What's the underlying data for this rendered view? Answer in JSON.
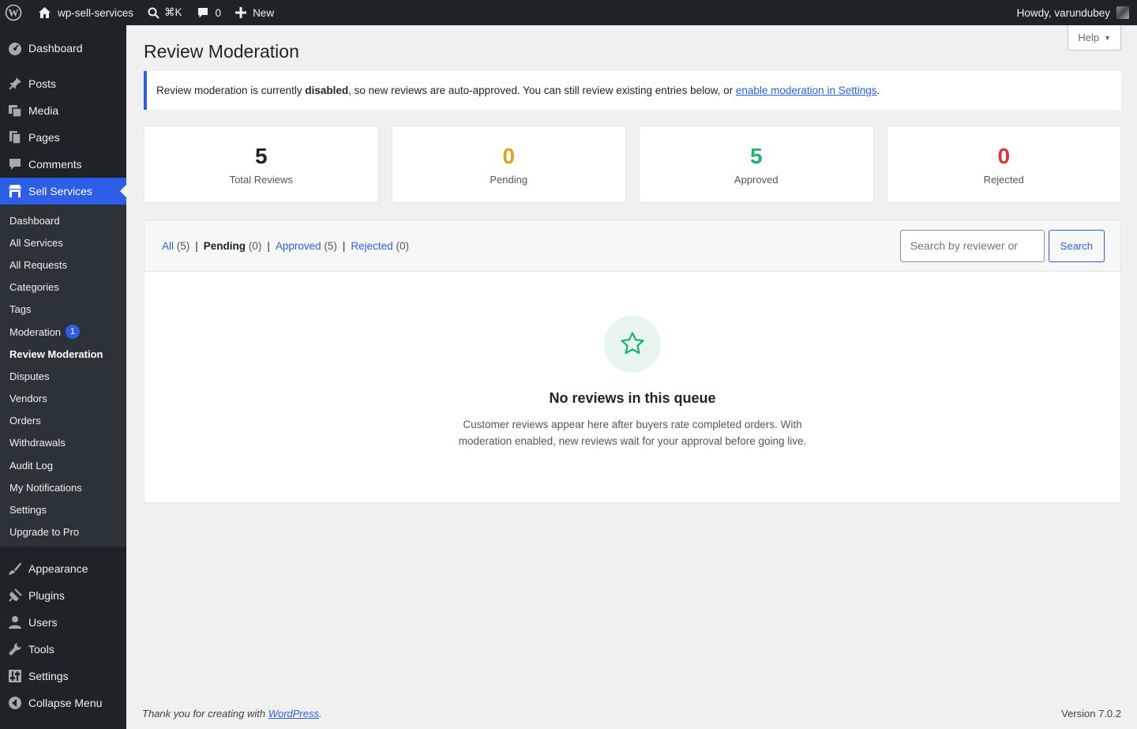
{
  "adminbar": {
    "site_name": "wp-sell-services",
    "search_shortcut": "⌘K",
    "comments_count": "0",
    "new_label": "New",
    "howdy": "Howdy, varundubey"
  },
  "sidebar": {
    "top_items": [
      {
        "label": "Dashboard"
      },
      {
        "label": "Posts"
      },
      {
        "label": "Media"
      },
      {
        "label": "Pages"
      },
      {
        "label": "Comments"
      },
      {
        "label": "Sell Services"
      }
    ],
    "submenu": [
      {
        "label": "Dashboard"
      },
      {
        "label": "All Services"
      },
      {
        "label": "All Requests"
      },
      {
        "label": "Categories"
      },
      {
        "label": "Tags"
      },
      {
        "label": "Moderation",
        "badge": "1"
      },
      {
        "label": "Review Moderation"
      },
      {
        "label": "Disputes"
      },
      {
        "label": "Vendors"
      },
      {
        "label": "Orders"
      },
      {
        "label": "Withdrawals"
      },
      {
        "label": "Audit Log"
      },
      {
        "label": "My Notifications"
      },
      {
        "label": "Settings"
      },
      {
        "label": "Upgrade to Pro"
      }
    ],
    "bottom_items": [
      {
        "label": "Appearance"
      },
      {
        "label": "Plugins"
      },
      {
        "label": "Users"
      },
      {
        "label": "Tools"
      },
      {
        "label": "Settings"
      },
      {
        "label": "Collapse Menu"
      }
    ]
  },
  "help_label": "Help",
  "page_title": "Review Moderation",
  "notice": {
    "text_before": "Review moderation is currently ",
    "bold": "disabled",
    "text_after": ", so new reviews are auto-approved. You can still review existing entries below, or ",
    "link": "enable moderation in Settings",
    "end": "."
  },
  "stats": [
    {
      "value": "5",
      "label": "Total Reviews",
      "color": "#1d2327"
    },
    {
      "value": "0",
      "label": "Pending",
      "color": "#dba617"
    },
    {
      "value": "5",
      "label": "Approved",
      "color": "#1fb36b"
    },
    {
      "value": "0",
      "label": "Rejected",
      "color": "#d63638"
    }
  ],
  "filters": [
    {
      "label": "All",
      "count": "(5)"
    },
    {
      "label": "Pending",
      "count": "(0)"
    },
    {
      "label": "Approved",
      "count": "(5)"
    },
    {
      "label": "Rejected",
      "count": "(0)"
    }
  ],
  "search": {
    "placeholder": "Search by reviewer or",
    "button": "Search"
  },
  "empty": {
    "title": "No reviews in this queue",
    "description": "Customer reviews appear here after buyers rate completed orders. With moderation enabled, new reviews wait for your approval before going live."
  },
  "footer": {
    "thanks_before": "Thank you for creating with ",
    "thanks_link": "WordPress",
    "thanks_after": ".",
    "version": "Version 7.0.2"
  },
  "colors": {
    "accent": "#2c5ee8",
    "sidebar_bg": "#1d2327",
    "success": "#1fb36b",
    "warning": "#dba617",
    "danger": "#d63638"
  }
}
